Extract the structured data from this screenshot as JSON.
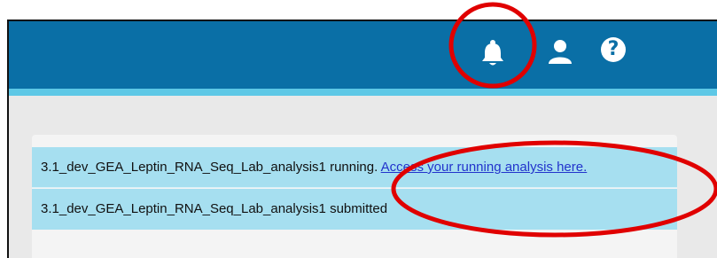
{
  "notifications": [
    {
      "analysis_name": "3.1_dev_GEA_Leptin_RNA_Seq_Lab_analysis1",
      "status": "running.",
      "link_label": "Access your running analysis here."
    },
    {
      "analysis_name": "3.1_dev_GEA_Leptin_RNA_Seq_Lab_analysis1",
      "status": "submitted"
    }
  ],
  "header": {
    "icons": [
      "bell-icon",
      "user-icon",
      "help-icon"
    ],
    "help_glyph": "?"
  },
  "colors": {
    "topbar": "#0a6fa6",
    "accent": "#5ec8e6",
    "notification_bg": "#a6dff0",
    "annotation": "#e00000",
    "link": "#2233cc"
  }
}
